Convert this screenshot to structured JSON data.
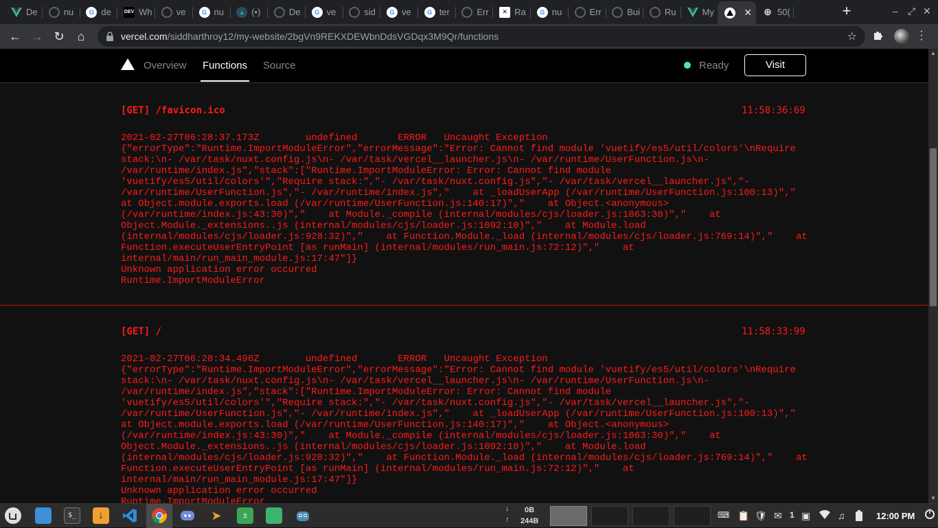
{
  "browser": {
    "tabs": [
      {
        "label": "De",
        "icon": "vue-icon",
        "color": "#41b883"
      },
      {
        "label": "nu",
        "icon": "github-icon",
        "color": "#555"
      },
      {
        "label": "de",
        "icon": "google-icon",
        "color": "#4285f4"
      },
      {
        "label": "Wh",
        "icon": "dev-icon",
        "color": "#000"
      },
      {
        "label": "ve",
        "icon": "github-icon",
        "color": "#555"
      },
      {
        "label": "nu",
        "icon": "google-icon",
        "color": "#4285f4"
      },
      {
        "label": "(•)",
        "icon": "nuxt-icon",
        "color": "#00c58e"
      },
      {
        "label": "De",
        "icon": "github-icon",
        "color": "#555"
      },
      {
        "label": "ve",
        "icon": "google-icon",
        "color": "#4285f4"
      },
      {
        "label": "sid",
        "icon": "github-icon",
        "color": "#555"
      },
      {
        "label": "ve",
        "icon": "google-icon",
        "color": "#4285f4"
      },
      {
        "label": "ter",
        "icon": "google-icon",
        "color": "#4285f4"
      },
      {
        "label": "Err",
        "icon": "github-icon",
        "color": "#555"
      },
      {
        "label": "Ra",
        "icon": "ray-icon",
        "color": "#fff"
      },
      {
        "label": "nu",
        "icon": "google-icon",
        "color": "#4285f4"
      },
      {
        "label": "Err",
        "icon": "github-icon",
        "color": "#555"
      },
      {
        "label": "Bui",
        "icon": "github-icon",
        "color": "#555"
      },
      {
        "label": "Ru",
        "icon": "github-icon",
        "color": "#555"
      },
      {
        "label": "My",
        "icon": "vue-icon",
        "color": "#41b883"
      },
      {
        "label": "",
        "icon": "vercel-icon",
        "color": "#000",
        "active": true
      },
      {
        "label": "50(",
        "icon": "globe-icon",
        "color": "#9aa0a6"
      }
    ],
    "url_host": "vercel.com",
    "url_path": "/siddharthroy12/my-website/2bgVn9REKXDEWbnDdsVGDqx3M9Qr/functions"
  },
  "vercel": {
    "nav": [
      "Overview",
      "Functions",
      "Source"
    ],
    "status": "Ready",
    "visit_label": "Visit",
    "status_color": "#50e3c2"
  },
  "logs": [
    {
      "request": "[GET] /favicon.ico",
      "time": "11:58:36:69",
      "lines": [
        "2021-02-27T06:28:37.173Z\tundefined\tERROR\tUncaught Exception",
        "{\"errorType\":\"Runtime.ImportModuleError\",\"errorMessage\":\"Error: Cannot find module 'vuetify/es5/util/colors'\\nRequire",
        "stack:\\n- /var/task/nuxt.config.js\\n- /var/task/vercel__launcher.js\\n- /var/runtime/UserFunction.js\\n-",
        "/var/runtime/index.js\",\"stack\":[\"Runtime.ImportModuleError: Error: Cannot find module",
        "'vuetify/es5/util/colors'\",\"Require stack:\",\"- /var/task/nuxt.config.js\",\"- /var/task/vercel__launcher.js\",\"-",
        "/var/runtime/UserFunction.js\",\"- /var/runtime/index.js\",\"    at _loadUserApp (/var/runtime/UserFunction.js:100:13)\",\"",
        "at Object.module.exports.load (/var/runtime/UserFunction.js:140:17)\",\"    at Object.<anonymous>",
        "(/var/runtime/index.js:43:30)\",\"    at Module._compile (internal/modules/cjs/loader.js:1063:30)\",\"    at",
        "Object.Module._extensions..js (internal/modules/cjs/loader.js:1092:10)\",\"    at Module.load",
        "(internal/modules/cjs/loader.js:928:32)\",\"    at Function.Module._load (internal/modules/cjs/loader.js:769:14)\",\"    at",
        "Function.executeUserEntryPoint [as runMain] (internal/modules/run_main.js:72:12)\",\"    at",
        "internal/main/run_main_module.js:17:47\"]}",
        "Unknown application error occurred",
        "Runtime.ImportModuleError"
      ]
    },
    {
      "request": "[GET] /",
      "time": "11:58:33:99",
      "lines": [
        "2021-02-27T06:28:34.496Z\tundefined\tERROR\tUncaught Exception",
        "{\"errorType\":\"Runtime.ImportModuleError\",\"errorMessage\":\"Error: Cannot find module 'vuetify/es5/util/colors'\\nRequire",
        "stack:\\n- /var/task/nuxt.config.js\\n- /var/task/vercel__launcher.js\\n- /var/runtime/UserFunction.js\\n-",
        "/var/runtime/index.js\",\"stack\":[\"Runtime.ImportModuleError: Error: Cannot find module",
        "'vuetify/es5/util/colors'\",\"Require stack:\",\"- /var/task/nuxt.config.js\",\"- /var/task/vercel__launcher.js\",\"-",
        "/var/runtime/UserFunction.js\",\"- /var/runtime/index.js\",\"    at _loadUserApp (/var/runtime/UserFunction.js:100:13)\",\"",
        "at Object.module.exports.load (/var/runtime/UserFunction.js:140:17)\",\"    at Object.<anonymous>",
        "(/var/runtime/index.js:43:30)\",\"    at Module._compile (internal/modules/cjs/loader.js:1063:30)\",\"    at",
        "Object.Module._extensions..js (internal/modules/cjs/loader.js:1092:10)\",\"    at Module.load",
        "(internal/modules/cjs/loader.js:928:32)\",\"    at Function.Module._load (internal/modules/cjs/loader.js:769:14)\",\"    at",
        "Function.executeUserEntryPoint [as runMain] (internal/modules/run_main.js:72:12)\",\"    at",
        "internal/main/run_main_module.js:17:47\"]}",
        "Unknown application error occurred",
        "Runtime.ImportModuleError"
      ]
    }
  ],
  "taskbar": {
    "apps": [
      "mint-menu-icon",
      "files-icon",
      "terminal-icon",
      "downloads-icon",
      "vscode-icon",
      "chrome-icon",
      "discord-icon",
      "postman-icon",
      "calculator-icon",
      "folder-icon",
      "godot-icon"
    ],
    "net_down": "0B",
    "net_up": "244B",
    "notification_count": "1",
    "clock": "12:00 PM"
  }
}
